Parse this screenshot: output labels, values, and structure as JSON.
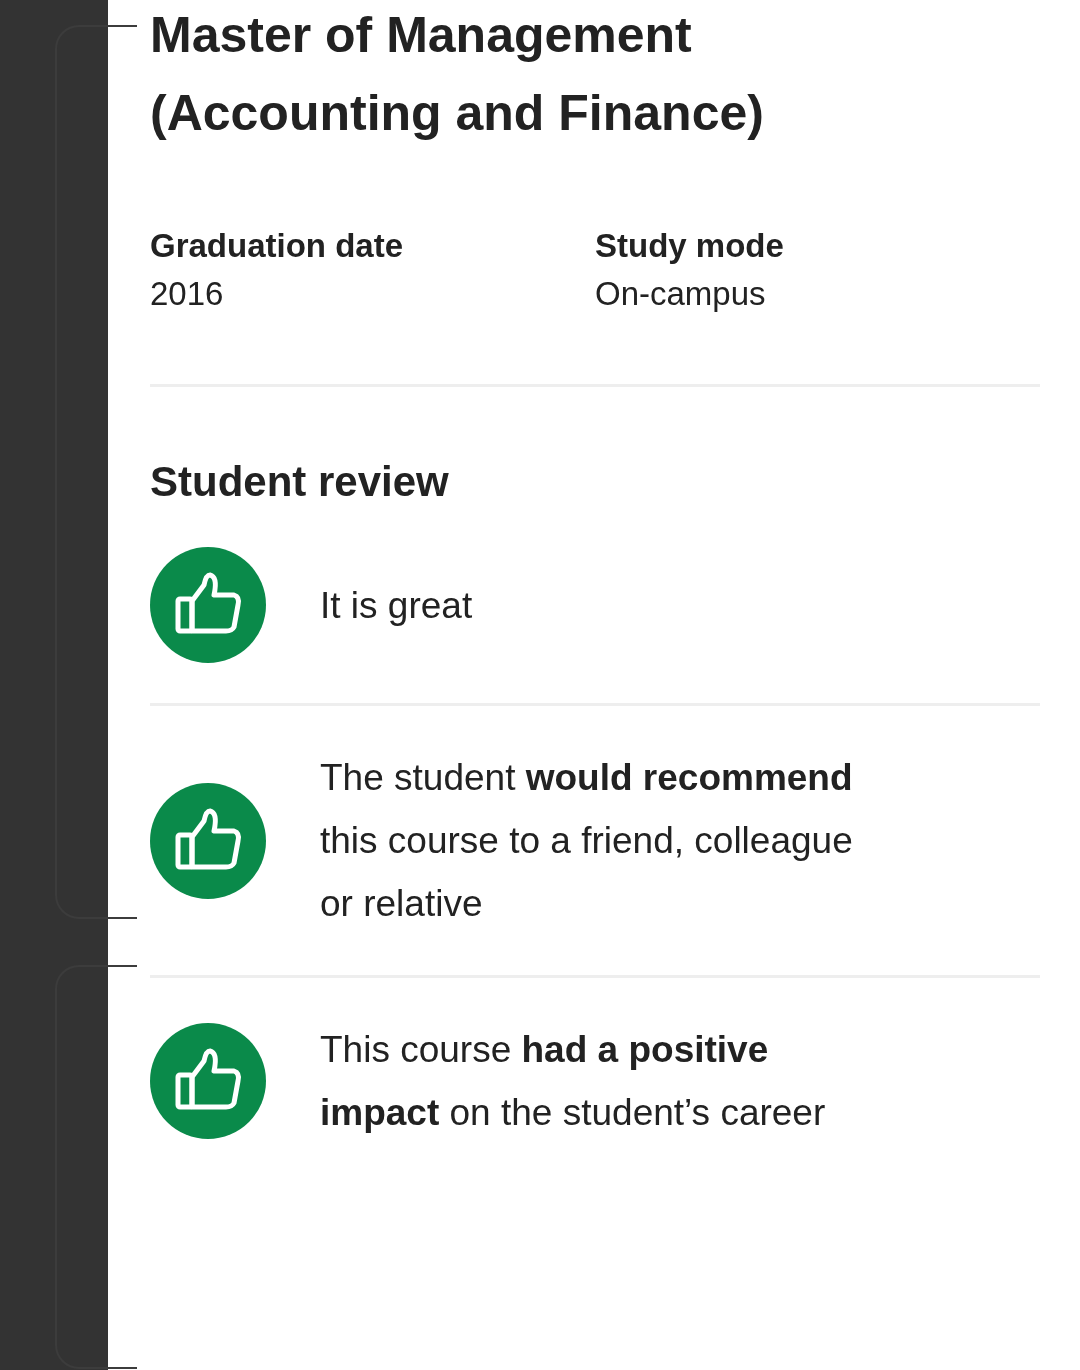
{
  "title": "Master of Management (Accounting and Finance)",
  "details": [
    {
      "label": "Graduation date",
      "value": "2016"
    },
    {
      "label": "Study mode",
      "value": "On-campus"
    }
  ],
  "review": {
    "heading": "Student review",
    "items": [
      {
        "text": "It is great"
      },
      {
        "text": "The student **would recommend** this course to a friend, colleague or relative"
      },
      {
        "text": "This course **had a positive impact** on the student’s career"
      }
    ]
  }
}
